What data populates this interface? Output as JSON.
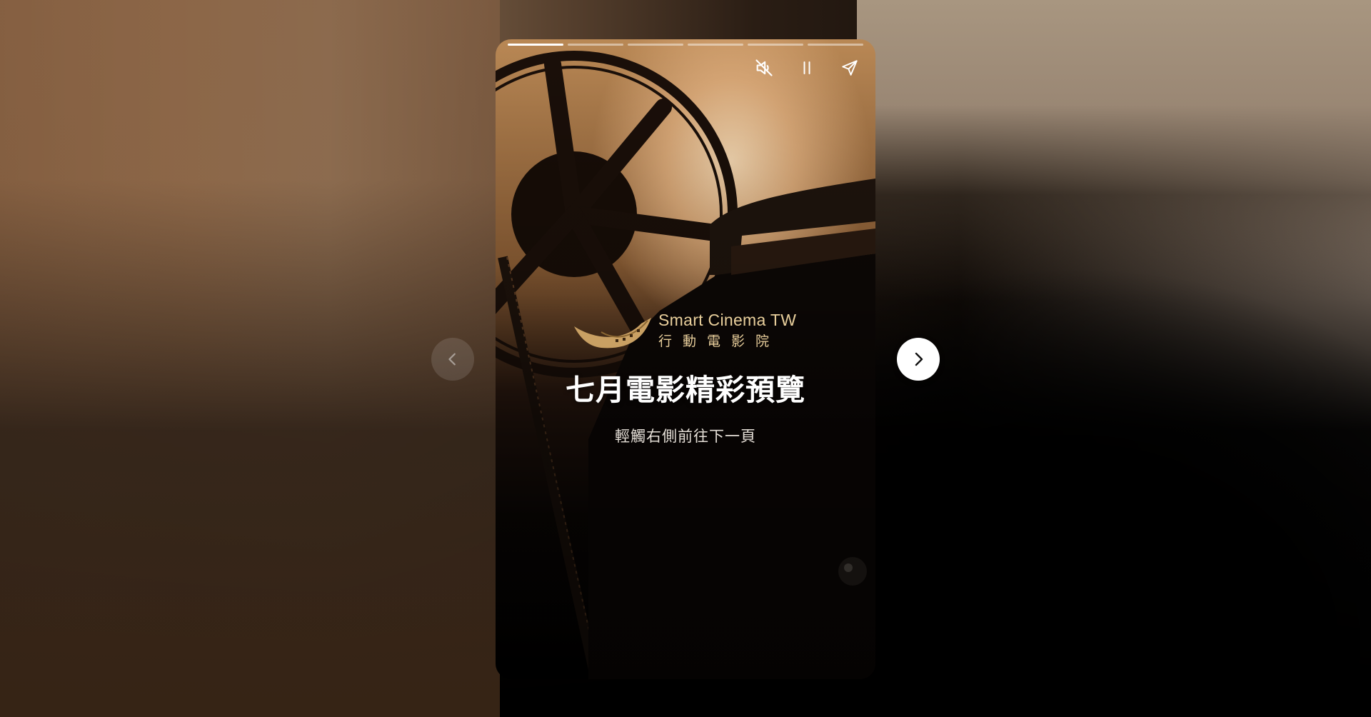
{
  "page": {
    "background_colors": [
      "#7d5a3c",
      "#8b7156",
      "#000000",
      "#a39080"
    ]
  },
  "story": {
    "progress": {
      "segment_count": 6,
      "active_index": 0,
      "active_color": "#ffffff",
      "inactive_color": "rgba(255,255,255,0.45)"
    },
    "controls": [
      {
        "name": "mute-toggle",
        "icon": "speaker-muted-icon"
      },
      {
        "name": "pause",
        "icon": "pause-icon"
      },
      {
        "name": "share",
        "icon": "send-icon"
      }
    ],
    "logo": {
      "name_en": "Smart Cinema TW",
      "name_zh": "行動電影院",
      "accent_color": "#e9cf9c"
    },
    "title": "七月電影精彩預覽",
    "hint": "輕觸右側前往下一頁"
  },
  "nav": {
    "prev_icon": "chevron-left-icon",
    "next_icon": "chevron-right-icon"
  }
}
